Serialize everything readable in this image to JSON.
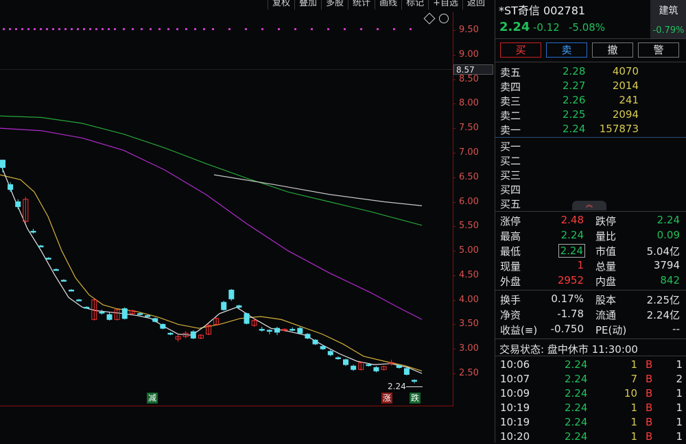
{
  "toolbar": [
    "复权",
    "叠加",
    "多股",
    "统计",
    "画线",
    "标记",
    "+自选",
    "返回"
  ],
  "y_axis_ticks": [
    "9.50",
    "9.00",
    "8.50",
    "8.00",
    "7.50",
    "7.00",
    "6.50",
    "6.00",
    "5.50",
    "5.00",
    "4.50",
    "4.00",
    "3.50",
    "3.00",
    "2.50"
  ],
  "crosshair_price": "8.57",
  "last_price_marker": "2.24",
  "markers": {
    "reduce": "减",
    "rise": "涨",
    "fall": "跌"
  },
  "chart_data": {
    "type": "candlestick",
    "ylim": [
      2.2,
      9.7
    ],
    "candles": [
      {
        "o": 6.85,
        "c": 6.7,
        "h": 6.85,
        "l": 6.6,
        "d": "dn"
      },
      {
        "o": 6.35,
        "c": 6.25,
        "h": 6.4,
        "l": 6.2,
        "d": "dn"
      },
      {
        "o": 6.0,
        "c": 5.9,
        "h": 6.05,
        "l": 5.85,
        "d": "dn"
      },
      {
        "o": 5.6,
        "c": 6.05,
        "h": 6.1,
        "l": 5.55,
        "d": "up"
      },
      {
        "o": 5.4,
        "c": 5.4,
        "h": 5.45,
        "l": 5.35,
        "d": "dn"
      },
      {
        "o": 5.1,
        "c": 5.1,
        "h": 5.12,
        "l": 5.08,
        "d": "dn"
      },
      {
        "o": 4.85,
        "c": 4.85,
        "h": 4.87,
        "l": 4.83,
        "d": "dn"
      },
      {
        "o": 4.62,
        "c": 4.62,
        "h": 4.64,
        "l": 4.6,
        "d": "dn"
      },
      {
        "o": 4.4,
        "c": 4.4,
        "h": 4.42,
        "l": 4.38,
        "d": "dn"
      },
      {
        "o": 4.2,
        "c": 4.2,
        "h": 4.22,
        "l": 4.18,
        "d": "dn"
      },
      {
        "o": 4.0,
        "c": 4.0,
        "h": 4.02,
        "l": 3.98,
        "d": "dn"
      },
      {
        "o": 3.85,
        "c": 3.85,
        "h": 3.87,
        "l": 3.83,
        "d": "dn"
      },
      {
        "o": 3.6,
        "c": 4.0,
        "h": 4.02,
        "l": 3.58,
        "d": "up"
      },
      {
        "o": 3.75,
        "c": 3.75,
        "h": 3.8,
        "l": 3.7,
        "d": "dn"
      },
      {
        "o": 3.7,
        "c": 3.6,
        "h": 3.75,
        "l": 3.58,
        "d": "dn"
      },
      {
        "o": 3.6,
        "c": 3.8,
        "h": 3.82,
        "l": 3.58,
        "d": "up"
      },
      {
        "o": 3.82,
        "c": 3.62,
        "h": 3.85,
        "l": 3.6,
        "d": "dn"
      },
      {
        "o": 3.72,
        "c": 3.78,
        "h": 3.8,
        "l": 3.7,
        "d": "up"
      },
      {
        "o": 3.72,
        "c": 3.7,
        "h": 3.74,
        "l": 3.68,
        "d": "dn"
      },
      {
        "o": 3.68,
        "c": 3.66,
        "h": 3.7,
        "l": 3.64,
        "d": "dn"
      },
      {
        "o": 3.62,
        "c": 3.56,
        "h": 3.64,
        "l": 3.54,
        "d": "dn"
      },
      {
        "o": 3.5,
        "c": 3.42,
        "h": 3.52,
        "l": 3.4,
        "d": "dn"
      },
      {
        "o": 3.32,
        "c": 3.3,
        "h": 3.34,
        "l": 3.28,
        "d": "dn"
      },
      {
        "o": 3.2,
        "c": 3.25,
        "h": 3.3,
        "l": 3.15,
        "d": "up"
      },
      {
        "o": 3.25,
        "c": 3.32,
        "h": 3.36,
        "l": 3.22,
        "d": "up"
      },
      {
        "o": 3.35,
        "c": 3.22,
        "h": 3.38,
        "l": 3.2,
        "d": "dn"
      },
      {
        "o": 3.28,
        "c": 3.22,
        "h": 3.3,
        "l": 3.2,
        "d": "up"
      },
      {
        "o": 3.3,
        "c": 3.48,
        "h": 3.5,
        "l": 3.28,
        "d": "up"
      },
      {
        "o": 3.5,
        "c": 3.62,
        "h": 3.64,
        "l": 3.48,
        "d": "up"
      },
      {
        "o": 3.8,
        "c": 3.95,
        "h": 3.98,
        "l": 3.78,
        "d": "dn"
      },
      {
        "o": 4.02,
        "c": 4.2,
        "h": 4.22,
        "l": 3.98,
        "d": "dn"
      },
      {
        "o": 3.88,
        "c": 3.85,
        "h": 3.9,
        "l": 3.8,
        "d": "dn"
      },
      {
        "o": 3.72,
        "c": 3.52,
        "h": 3.74,
        "l": 3.5,
        "d": "dn"
      },
      {
        "o": 3.48,
        "c": 3.58,
        "h": 3.62,
        "l": 3.45,
        "d": "up"
      },
      {
        "o": 3.4,
        "c": 3.4,
        "h": 3.45,
        "l": 3.35,
        "d": "dn"
      },
      {
        "o": 3.38,
        "c": 3.36,
        "h": 3.4,
        "l": 3.3,
        "d": "dn"
      },
      {
        "o": 3.42,
        "c": 3.34,
        "h": 3.45,
        "l": 3.28,
        "d": "dn"
      },
      {
        "o": 3.38,
        "c": 3.4,
        "h": 3.42,
        "l": 3.35,
        "d": "up"
      },
      {
        "o": 3.4,
        "c": 3.38,
        "h": 3.44,
        "l": 3.36,
        "d": "dn"
      },
      {
        "o": 3.42,
        "c": 3.32,
        "h": 3.45,
        "l": 3.3,
        "d": "dn"
      },
      {
        "o": 3.3,
        "c": 3.22,
        "h": 3.32,
        "l": 3.2,
        "d": "dn"
      },
      {
        "o": 3.18,
        "c": 3.1,
        "h": 3.2,
        "l": 3.08,
        "d": "dn"
      },
      {
        "o": 3.05,
        "c": 3.0,
        "h": 3.08,
        "l": 2.98,
        "d": "dn"
      },
      {
        "o": 2.95,
        "c": 2.88,
        "h": 2.98,
        "l": 2.85,
        "d": "dn"
      },
      {
        "o": 2.82,
        "c": 2.8,
        "h": 2.85,
        "l": 2.78,
        "d": "dn"
      },
      {
        "o": 2.78,
        "c": 2.68,
        "h": 2.8,
        "l": 2.65,
        "d": "dn"
      },
      {
        "o": 2.65,
        "c": 2.58,
        "h": 2.68,
        "l": 2.55,
        "d": "dn"
      },
      {
        "o": 2.58,
        "c": 2.72,
        "h": 2.75,
        "l": 2.56,
        "d": "up"
      },
      {
        "o": 2.68,
        "c": 2.66,
        "h": 2.7,
        "l": 2.64,
        "d": "dn"
      },
      {
        "o": 2.62,
        "c": 2.55,
        "h": 2.65,
        "l": 2.52,
        "d": "dn"
      },
      {
        "o": 2.58,
        "c": 2.64,
        "h": 2.66,
        "l": 2.56,
        "d": "up"
      },
      {
        "o": 2.7,
        "c": 2.72,
        "h": 2.78,
        "l": 2.66,
        "d": "up"
      },
      {
        "o": 2.66,
        "c": 2.62,
        "h": 2.68,
        "l": 2.6,
        "d": "dn"
      },
      {
        "o": 2.6,
        "c": 2.48,
        "h": 2.62,
        "l": 2.46,
        "d": "dn"
      },
      {
        "o": 2.36,
        "c": 2.36,
        "h": 2.38,
        "l": 2.3,
        "d": "dn"
      }
    ],
    "ma_white": [
      [
        0,
        6.8
      ],
      [
        20,
        6.1
      ],
      [
        40,
        5.45
      ],
      [
        60,
        5.0
      ],
      [
        80,
        4.5
      ],
      [
        100,
        4.05
      ],
      [
        120,
        3.85
      ],
      [
        140,
        3.78
      ],
      [
        160,
        3.75
      ],
      [
        180,
        3.72
      ],
      [
        200,
        3.68
      ],
      [
        220,
        3.62
      ],
      [
        240,
        3.45
      ],
      [
        260,
        3.3
      ],
      [
        280,
        3.28
      ],
      [
        300,
        3.48
      ],
      [
        320,
        3.72
      ],
      [
        345,
        3.85
      ],
      [
        370,
        3.62
      ],
      [
        395,
        3.42
      ],
      [
        420,
        3.36
      ],
      [
        445,
        3.28
      ],
      [
        470,
        3.08
      ],
      [
        495,
        2.9
      ],
      [
        520,
        2.75
      ],
      [
        545,
        2.68
      ],
      [
        570,
        2.7
      ],
      [
        595,
        2.62
      ],
      [
        615,
        2.5
      ]
    ],
    "ma_yellow": [
      [
        0,
        6.55
      ],
      [
        30,
        6.45
      ],
      [
        50,
        6.2
      ],
      [
        70,
        5.7
      ],
      [
        90,
        5.0
      ],
      [
        110,
        4.45
      ],
      [
        130,
        4.1
      ],
      [
        150,
        3.9
      ],
      [
        170,
        3.82
      ],
      [
        200,
        3.76
      ],
      [
        230,
        3.65
      ],
      [
        260,
        3.5
      ],
      [
        290,
        3.42
      ],
      [
        320,
        3.5
      ],
      [
        350,
        3.62
      ],
      [
        380,
        3.66
      ],
      [
        410,
        3.6
      ],
      [
        440,
        3.45
      ],
      [
        470,
        3.3
      ],
      [
        500,
        3.1
      ],
      [
        530,
        2.85
      ],
      [
        560,
        2.75
      ],
      [
        590,
        2.66
      ],
      [
        615,
        2.55
      ]
    ],
    "ma_magenta": [
      [
        0,
        7.5
      ],
      [
        60,
        7.45
      ],
      [
        120,
        7.3
      ],
      [
        180,
        7.05
      ],
      [
        240,
        6.65
      ],
      [
        300,
        6.15
      ],
      [
        360,
        5.55
      ],
      [
        420,
        5.0
      ],
      [
        480,
        4.55
      ],
      [
        540,
        4.15
      ],
      [
        580,
        3.85
      ],
      [
        615,
        3.6
      ]
    ],
    "ma_green": [
      [
        0,
        7.75
      ],
      [
        60,
        7.72
      ],
      [
        120,
        7.6
      ],
      [
        180,
        7.38
      ],
      [
        240,
        7.1
      ],
      [
        300,
        6.78
      ],
      [
        360,
        6.48
      ],
      [
        420,
        6.2
      ],
      [
        480,
        6.0
      ],
      [
        540,
        5.8
      ],
      [
        580,
        5.65
      ],
      [
        615,
        5.52
      ]
    ],
    "ma_grey": [
      [
        312,
        6.55
      ],
      [
        400,
        6.35
      ],
      [
        480,
        6.15
      ],
      [
        560,
        6.0
      ],
      [
        615,
        5.92
      ]
    ]
  },
  "stock": {
    "name": "*ST奇信 002781",
    "price": "2.24",
    "change": "-0.12",
    "change_pct": "-5.08%",
    "sector": "建筑",
    "sector_pct": "-0.79%"
  },
  "buttons": [
    "买",
    "卖",
    "撤",
    "警"
  ],
  "asks": [
    {
      "label": "卖五",
      "price": "2.28",
      "vol": "4070"
    },
    {
      "label": "卖四",
      "price": "2.27",
      "vol": "2014"
    },
    {
      "label": "卖三",
      "price": "2.26",
      "vol": "241"
    },
    {
      "label": "卖二",
      "price": "2.25",
      "vol": "2094"
    },
    {
      "label": "卖一",
      "price": "2.24",
      "vol": "157873"
    }
  ],
  "bids": [
    {
      "label": "买一"
    },
    {
      "label": "买二"
    },
    {
      "label": "买三"
    },
    {
      "label": "买四"
    },
    {
      "label": "买五"
    }
  ],
  "collapse_icon": "chevron-up",
  "stats": [
    {
      "l1": "涨停",
      "v1": "2.48",
      "c1": "r",
      "l2": "跌停",
      "v2": "2.24",
      "c2": "g"
    },
    {
      "l1": "最高",
      "v1": "2.24",
      "c1": "g",
      "l2": "量比",
      "v2": "0.09",
      "c2": "g"
    },
    {
      "l1": "最低",
      "v1": "2.24",
      "c1": "g",
      "l2": "市值",
      "v2": "5.04亿",
      "c2": "w"
    },
    {
      "l1": "现量",
      "v1": "1",
      "c1": "r",
      "l2": "总量",
      "v2": "3794",
      "c2": "w"
    },
    {
      "l1": "外盘",
      "v1": "2952",
      "c1": "r",
      "l2": "内盘",
      "v2": "842",
      "c2": "g"
    }
  ],
  "stats2": [
    {
      "l1": "换手",
      "v1": "0.17%",
      "l2": "股本",
      "v2": "2.25亿"
    },
    {
      "l1": "净资",
      "v1": "-1.78",
      "l2": "流通",
      "v2": "2.24亿"
    },
    {
      "l1": "收益(≡)",
      "v1": "-0.750",
      "l2": "PE(动)",
      "v2": "--"
    }
  ],
  "trade_status": "交易状态: 盘中休市 11:30:00",
  "ticks": [
    {
      "t": "10:06",
      "p": "2.24",
      "v": "1",
      "s": "B",
      "n": "1"
    },
    {
      "t": "10:07",
      "p": "2.24",
      "v": "7",
      "s": "B",
      "n": "2"
    },
    {
      "t": "10:09",
      "p": "2.24",
      "v": "10",
      "s": "B",
      "n": "1"
    },
    {
      "t": "10:19",
      "p": "2.24",
      "v": "1",
      "s": "B",
      "n": "1"
    },
    {
      "t": "10:19",
      "p": "2.24",
      "v": "1",
      "s": "B",
      "n": "1"
    },
    {
      "t": "10:20",
      "p": "2.24",
      "v": "1",
      "s": "B",
      "n": "1"
    }
  ],
  "colors": {
    "up": "#ff3333",
    "down": "#5ce1ee",
    "bg": "#07080a",
    "axis": "#8a1010"
  }
}
